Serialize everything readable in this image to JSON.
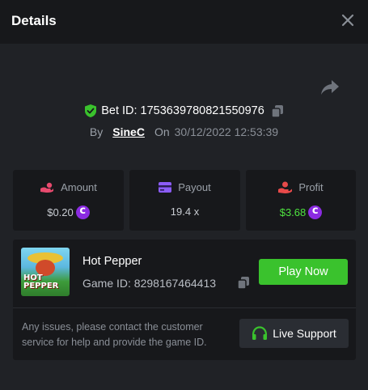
{
  "header": {
    "title": "Details"
  },
  "bet": {
    "label": "Bet ID: 1753639780821550976",
    "by_label": "By",
    "user": "SineC",
    "on_label": "On",
    "date": "30/12/2022 12:53:39"
  },
  "stats": {
    "amount": {
      "label": "Amount",
      "value": "$0.20",
      "icon": "hand-coin-icon"
    },
    "payout": {
      "label": "Payout",
      "value": "19.4 x",
      "icon": "card-icon"
    },
    "profit": {
      "label": "Profit",
      "value": "$3.68",
      "icon": "hand-money-icon"
    }
  },
  "game": {
    "thumb_text": "HOT PEPPER",
    "name": "Hot Pepper",
    "id_label": "Game ID: 8298167464413",
    "play_label": "Play Now"
  },
  "support": {
    "text": "Any issues, please contact the customer service for help and provide the game ID.",
    "button_label": "Live Support"
  },
  "colors": {
    "accent_green": "#3ac22d",
    "profit_green": "#4ee33f",
    "coin_purple": "#8b2be2",
    "panel_bg": "#17181b",
    "page_bg": "#202226"
  }
}
